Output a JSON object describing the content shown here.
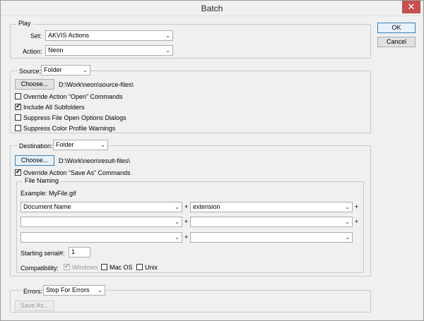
{
  "window": {
    "title": "Batch",
    "close_glyph": "✕"
  },
  "buttons": {
    "ok": "OK",
    "cancel": "Cancel"
  },
  "play": {
    "legend": "Play",
    "set_label": "Set:",
    "set_value": "AKVIS Actions",
    "action_label": "Action:",
    "action_value": "Neon"
  },
  "source": {
    "legend_label": "Source:",
    "type_value": "Folder",
    "choose_label": "Choose...",
    "path": "D:\\Work\\neon\\source-files\\",
    "options": [
      {
        "label": "Override Action “Open” Commands",
        "checked": false
      },
      {
        "label": "Include All Subfolders",
        "checked": true
      },
      {
        "label": "Suppress File Open Options Dialogs",
        "checked": false
      },
      {
        "label": "Suppress Color Profile Warnings",
        "checked": false
      }
    ]
  },
  "destination": {
    "legend_label": "Destination:",
    "type_value": "Folder",
    "choose_label": "Choose...",
    "path": "D:\\Work\\neon\\result-files\\",
    "override_label": "Override Action “Save As” Commands",
    "override_checked": true,
    "file_naming": {
      "legend": "File Naming",
      "example": "Example: MyFile.gif",
      "rows": [
        {
          "left": "Document Name",
          "right": "extension"
        },
        {
          "left": "",
          "right": ""
        },
        {
          "left": "",
          "right": ""
        }
      ],
      "plus": "+",
      "serial_label": "Starting serial#:",
      "serial_value": "1",
      "compat_label": "Compatibility:",
      "compat": [
        {
          "label": "Windows",
          "checked": true,
          "disabled": true
        },
        {
          "label": "Mac OS",
          "checked": false,
          "disabled": false
        },
        {
          "label": "Unix",
          "checked": false,
          "disabled": false
        }
      ]
    }
  },
  "errors": {
    "label": "Errors:",
    "value": "Stop For Errors",
    "save_as_label": "Save As..."
  },
  "icons": {
    "dropdown": "⌄"
  }
}
